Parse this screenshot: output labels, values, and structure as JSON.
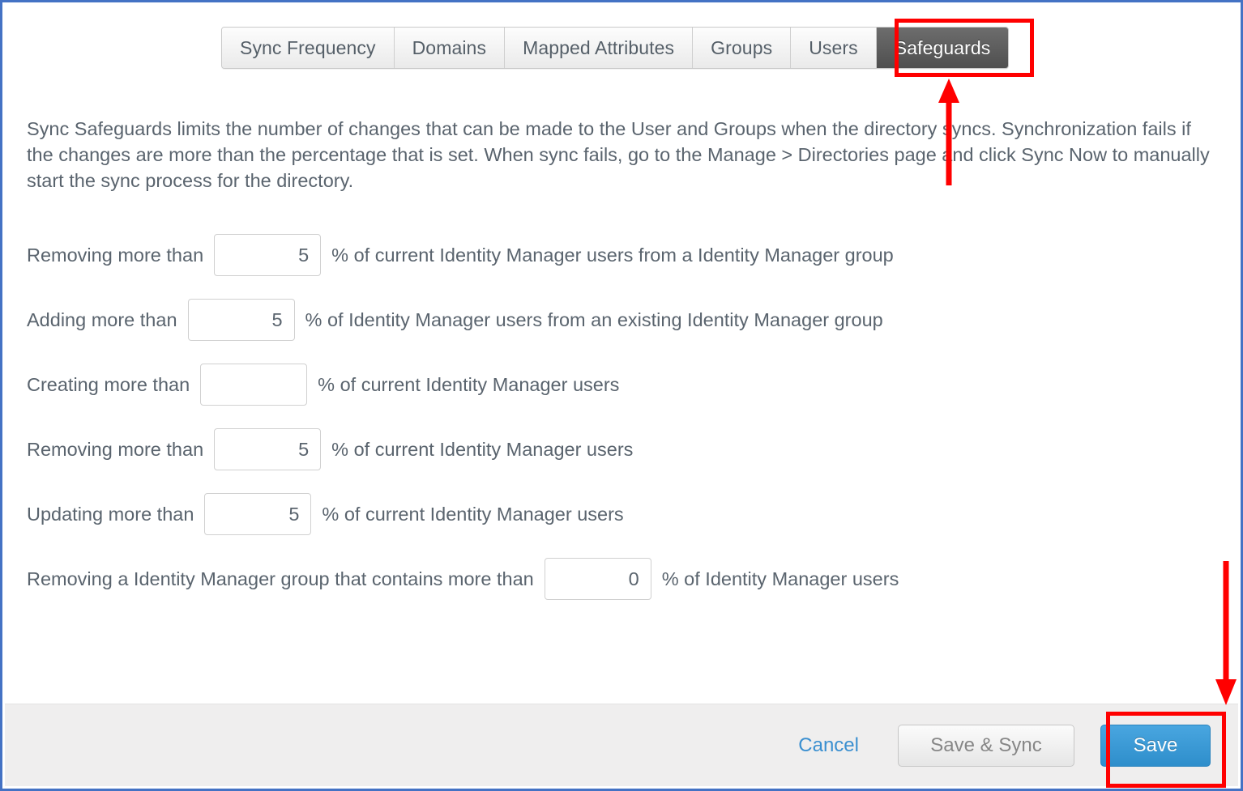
{
  "tabs": [
    {
      "label": "Sync Frequency",
      "active": false
    },
    {
      "label": "Domains",
      "active": false
    },
    {
      "label": "Mapped Attributes",
      "active": false
    },
    {
      "label": "Groups",
      "active": false
    },
    {
      "label": "Users",
      "active": false
    },
    {
      "label": "Safeguards",
      "active": true
    }
  ],
  "description": "Sync Safeguards limits the number of changes that can be made to the User and Groups when the directory syncs. Synchronization fails if the changes are more than the percentage that is set. When sync fails, go to the Manage > Directories page and click Sync Now to manually start the sync process for the directory.",
  "form": {
    "rows": [
      {
        "label": "Removing more than",
        "value": "5",
        "suffix": "% of current Identity Manager users from a Identity Manager group"
      },
      {
        "label": "Adding more than",
        "value": "5",
        "suffix": "% of Identity Manager users from an existing Identity Manager group"
      },
      {
        "label": "Creating more than",
        "value": "",
        "suffix": "% of current Identity Manager users"
      },
      {
        "label": "Removing more than",
        "value": "5",
        "suffix": "% of current Identity Manager users"
      },
      {
        "label": "Updating more than",
        "value": "5",
        "suffix": "% of current Identity Manager users"
      },
      {
        "label": "Removing a Identity Manager group that contains more than",
        "value": "0",
        "suffix": "% of Identity Manager users"
      }
    ]
  },
  "footer": {
    "cancel_label": "Cancel",
    "save_sync_label": "Save & Sync",
    "save_label": "Save"
  },
  "annotations": {
    "highlight_color": "#ff0000",
    "arrow_up_target": "Safeguards",
    "arrow_down_target": "Save"
  },
  "colors": {
    "page_border": "#4472c4",
    "active_tab_bg": "#5a5a5a",
    "primary_button": "#3a93d3",
    "link": "#3a8fd0",
    "text": "#5a646e",
    "footer_bg": "#efeeee"
  }
}
